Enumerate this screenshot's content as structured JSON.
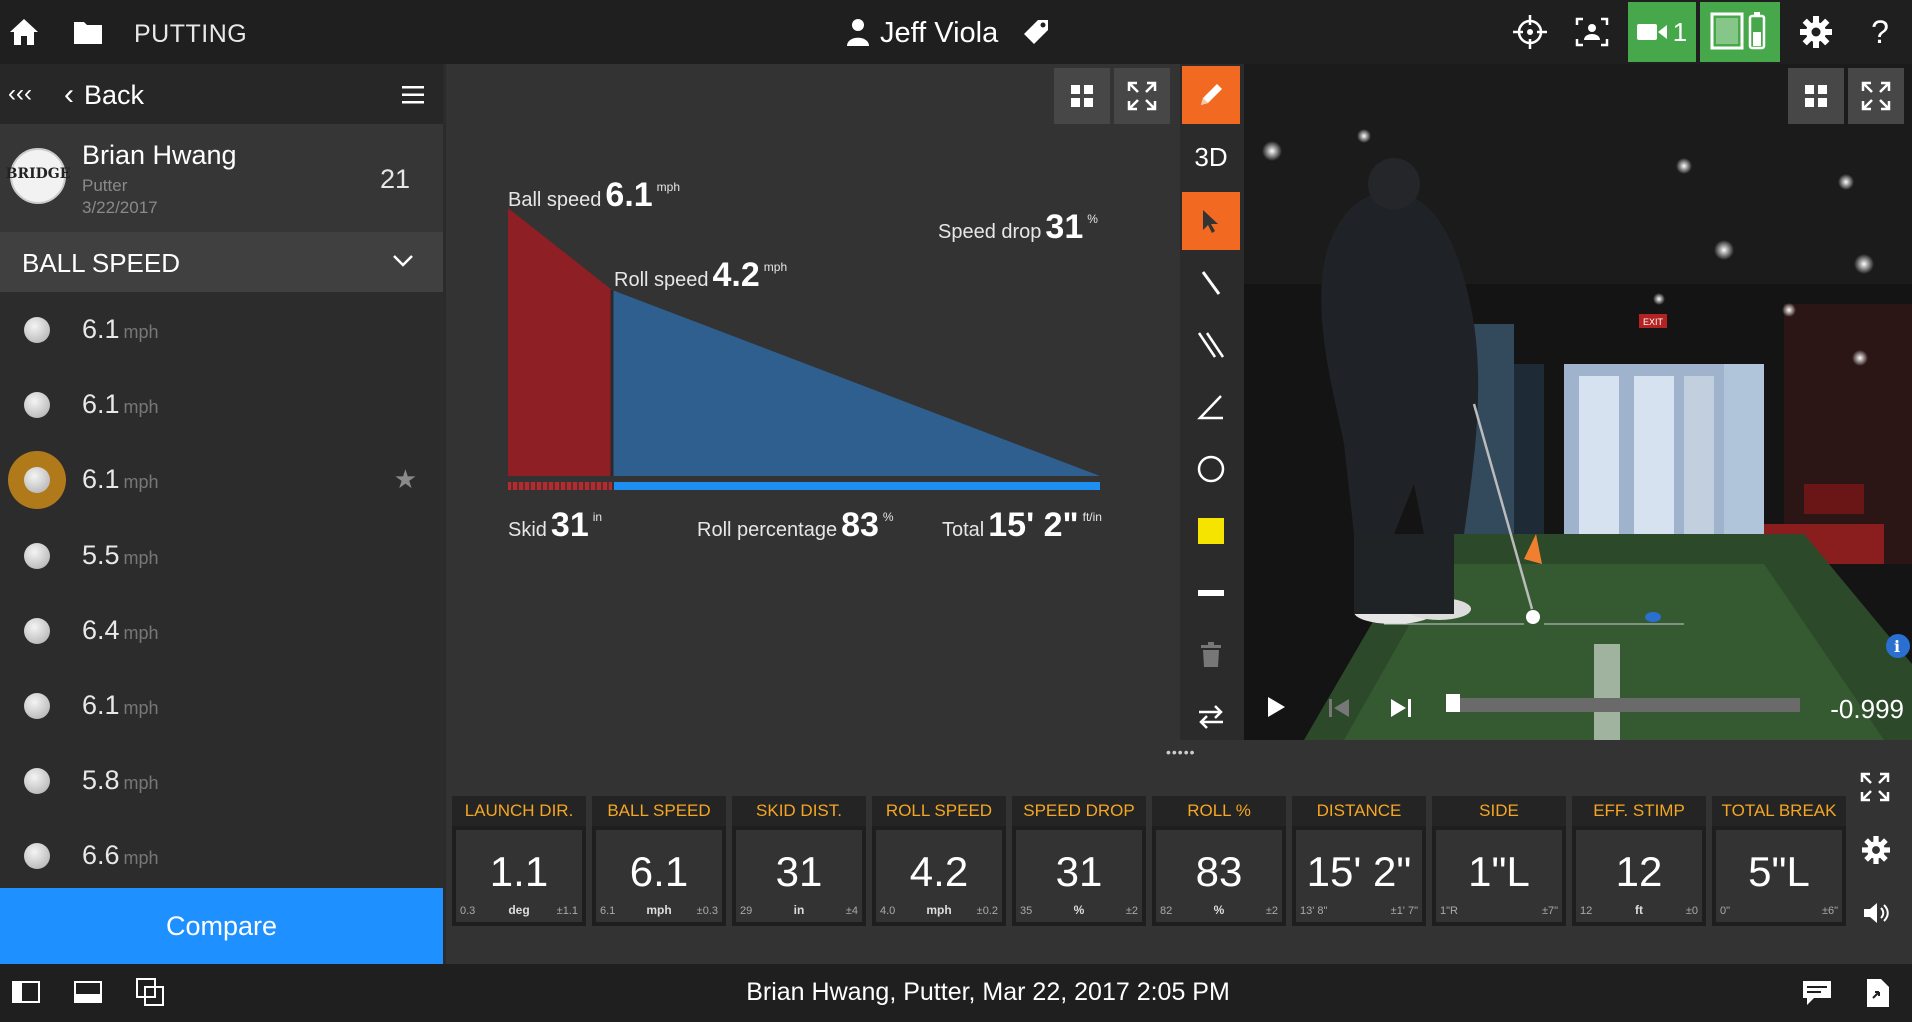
{
  "topbar": {
    "title": "PUTTING",
    "user": "Jeff Viola",
    "camera_count": "1"
  },
  "sidebar": {
    "back": "Back",
    "player": {
      "name": "Brian Hwang",
      "logo_text": "BRIDGE",
      "club": "Putter",
      "date": "3/22/2017",
      "count": "21"
    },
    "metric": "BALL SPEED",
    "shots": [
      {
        "value": "6.1",
        "unit": "mph"
      },
      {
        "value": "6.1",
        "unit": "mph"
      },
      {
        "value": "6.1",
        "unit": "mph",
        "selected": true
      },
      {
        "value": "5.5",
        "unit": "mph"
      },
      {
        "value": "6.4",
        "unit": "mph"
      },
      {
        "value": "6.1",
        "unit": "mph"
      },
      {
        "value": "5.8",
        "unit": "mph"
      },
      {
        "value": "6.6",
        "unit": "mph"
      }
    ],
    "compare": "Compare"
  },
  "chart": {
    "ball_speed_label": "Ball speed",
    "ball_speed": "6.1",
    "ball_speed_unit": "mph",
    "roll_speed_label": "Roll speed",
    "roll_speed": "4.2",
    "roll_speed_unit": "mph",
    "speed_drop_label": "Speed drop",
    "speed_drop": "31",
    "speed_drop_unit": "%",
    "skid_label": "Skid",
    "skid": "31",
    "skid_unit": "in",
    "roll_pct_label": "Roll percentage",
    "roll_pct": "83",
    "roll_pct_unit": "%",
    "total_label": "Total",
    "total": "15' 2\"",
    "total_unit": "ft/in"
  },
  "tools": {
    "dl": "DL",
    "three_d": "3D",
    "highlight_color": "#f26a21",
    "swatch_color": "#f5e400"
  },
  "video": {
    "time": "-0.999",
    "exit_sign": "EXIT"
  },
  "stats": [
    {
      "header": "LAUNCH DIR.",
      "value": "1.1",
      "low": "0.3",
      "unit": "deg",
      "tol": "±1.1"
    },
    {
      "header": "BALL SPEED",
      "value": "6.1",
      "low": "6.1",
      "unit": "mph",
      "tol": "±0.3"
    },
    {
      "header": "SKID DIST.",
      "value": "31",
      "low": "29",
      "unit": "in",
      "tol": "±4"
    },
    {
      "header": "ROLL SPEED",
      "value": "4.2",
      "low": "4.0",
      "unit": "mph",
      "tol": "±0.2"
    },
    {
      "header": "SPEED DROP",
      "value": "31",
      "low": "35",
      "unit": "%",
      "tol": "±2"
    },
    {
      "header": "ROLL %",
      "value": "83",
      "low": "82",
      "unit": "%",
      "tol": "±2"
    },
    {
      "header": "DISTANCE",
      "value": "15' 2\"",
      "low": "13' 8\"",
      "unit": "",
      "tol": "±1' 7\""
    },
    {
      "header": "SIDE",
      "value": "1\"L",
      "low": "1\"R",
      "unit": "",
      "tol": "±7\""
    },
    {
      "header": "EFF. STIMP",
      "value": "12",
      "low": "12",
      "unit": "ft",
      "tol": "±0"
    },
    {
      "header": "TOTAL BREAK",
      "value": "5\"L",
      "low": "0\"",
      "unit": "",
      "tol": "±6\""
    }
  ],
  "footer": {
    "summary": "Brian Hwang, Putter, Mar 22, 2017 2:05 PM"
  }
}
